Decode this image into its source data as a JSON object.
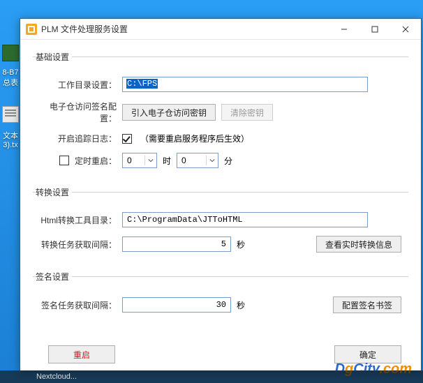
{
  "window": {
    "title": "PLM 文件处理服务设置"
  },
  "desktop": {
    "file1": "8-B7",
    "file2": "总表",
    "file3": "文本",
    "file4": "3).tx"
  },
  "group_basic": {
    "legend": "基础设置",
    "workdir_label": "工作目录设置",
    "workdir_value": "C:\\FPS",
    "sign_cfg_label": "电子仓访问签名配置",
    "btn_import_key": "引入电子仓访问密钥",
    "btn_clear_key": "清除密钥",
    "trace_label": "开启追踪日志",
    "trace_hint": "（需要重启服务程序后生效）",
    "restart_label": "定时重启",
    "hour_value": "0",
    "hour_unit": "时",
    "minute_value": "0",
    "minute_unit": "分"
  },
  "group_convert": {
    "legend": "转换设置",
    "tooldir_label": "Html转换工具目录",
    "tooldir_value": "C:\\ProgramData\\JTToHTML",
    "interval_label": "转换任务获取间隔",
    "interval_value": "5",
    "interval_unit": "秒",
    "btn_realtime": "查看实时转换信息"
  },
  "group_sign": {
    "legend": "签名设置",
    "interval_label": "签名任务获取间隔",
    "interval_value": "30",
    "interval_unit": "秒",
    "btn_bookmark": "配置签名书签"
  },
  "footer": {
    "btn_restart": "重启",
    "btn_ok": "确定"
  },
  "taskbar": {
    "item": "Nextcloud..."
  },
  "watermark": {
    "p1": "D",
    "p2": "g",
    "p3": "City",
    "p4": ".com"
  }
}
